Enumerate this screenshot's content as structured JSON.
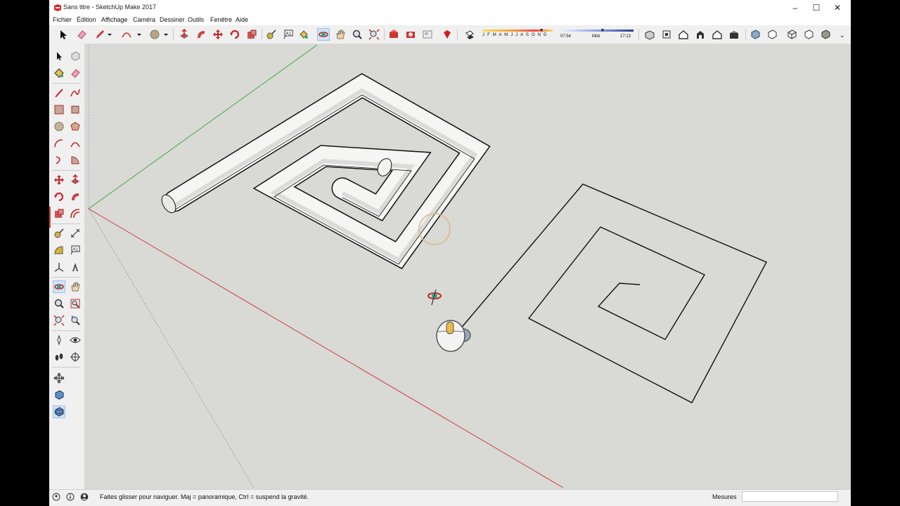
{
  "window": {
    "title": "Sans titre - SketchUp Make 2017"
  },
  "menu": [
    "Fichier",
    "Édition",
    "Affichage",
    "Caméra",
    "Dessiner",
    "Outils",
    "Fenêtre",
    "Aide"
  ],
  "shadow_toolbar": {
    "months": "J F M A M J J A S O N D",
    "time_start": "07:54",
    "time_mid": "Midi",
    "time_end": "17:13"
  },
  "status": {
    "message": "Faites glisser pour naviguer. Maj = panoramique, Ctrl =  suspend la gravité.",
    "measure_label": "Mesures",
    "measure_value": ""
  },
  "icons": {
    "main_toolbar": [
      "select-icon",
      "eraser-icon",
      "pencil-icon",
      "line-dropdown-icon",
      "arc-icon",
      "arc-dropdown-icon",
      "circle-icon",
      "circle-dropdown-icon",
      "push-pull-icon",
      "follow-me-icon",
      "move-icon",
      "rotate-icon",
      "scale-icon",
      "tape-measure-icon",
      "text-icon",
      "paint-bucket-icon",
      "orbit-icon",
      "pan-icon",
      "zoom-icon",
      "zoom-extents-icon",
      "warehouse-icon",
      "extension-warehouse-icon",
      "layout-icon",
      "ruby-icon",
      "shadows-toggle-icon",
      "iso-view-icon",
      "top-view-icon",
      "front-view-icon",
      "right-view-icon",
      "back-view-icon",
      "left-view-icon",
      "xray-icon",
      "back-edges-icon",
      "wireframe-icon",
      "hidden-line-icon",
      "shaded-icon",
      "shaded-texture-icon"
    ],
    "large_toolset": [
      "select-icon",
      "make-component-icon",
      "paint-bucket-icon",
      "eraser-icon",
      "line-icon",
      "freehand-icon",
      "rectangle-icon",
      "rotated-rectangle-icon",
      "circle-icon",
      "polygon-icon",
      "arc-icon",
      "two-point-arc-icon",
      "three-point-arc-icon",
      "pie-icon",
      "move-icon",
      "push-pull-icon",
      "rotate-icon",
      "follow-me-icon",
      "scale-icon",
      "offset-icon",
      "tape-measure-icon",
      "dimension-icon",
      "protractor-icon",
      "text-icon",
      "axes-icon",
      "3d-text-icon",
      "orbit-icon",
      "pan-icon",
      "zoom-icon",
      "zoom-window-icon",
      "zoom-extents-icon",
      "previous-view-icon",
      "position-camera-icon",
      "look-around-icon",
      "walk-icon",
      "section-plane-icon",
      "move-icon",
      "orbit-icon",
      "orbit-active-icon"
    ]
  },
  "colors": {
    "viewport_bg": "#d9d9d5",
    "axis_green": "#3aa63a",
    "axis_red": "#cc3333",
    "selection_highlight": "#cde4f7"
  }
}
